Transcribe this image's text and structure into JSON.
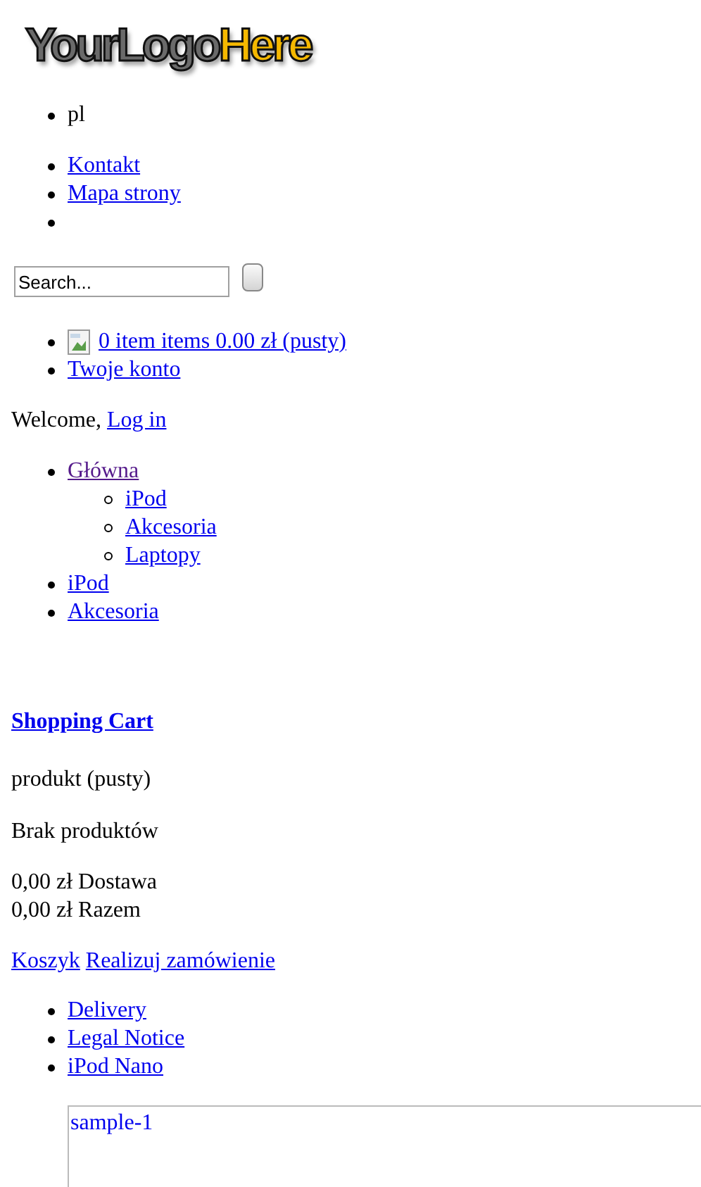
{
  "logo": {
    "text_1": "YourLogo",
    "text_2": "Here"
  },
  "language_list": [
    "pl"
  ],
  "top_links": [
    {
      "kind": "link",
      "label": "Kontakt"
    },
    {
      "kind": "link",
      "label": "Mapa strony"
    },
    {
      "kind": "empty"
    }
  ],
  "search": {
    "placeholder": "Search..."
  },
  "user_links": [
    {
      "kind": "cart",
      "label": "0 item items 0.00 zł (pusty)"
    },
    {
      "kind": "link",
      "label": "Twoje konto"
    }
  ],
  "welcome": {
    "text": "Welcome,",
    "link": "Log in"
  },
  "categories": [
    {
      "label": "Główna",
      "visited": true,
      "children": [
        {
          "label": "iPod",
          "visited": false
        },
        {
          "label": "Akcesoria",
          "visited": false
        },
        {
          "label": "Laptopy",
          "visited": false
        }
      ]
    },
    {
      "label": "iPod",
      "visited": false
    },
    {
      "label": "Akcesoria",
      "visited": false
    }
  ],
  "cart": {
    "title": "Shopping Cart",
    "product_line": "produkt (pusty)",
    "empty_message": "Brak produktów",
    "totals": [
      {
        "amount": "0,00 zł",
        "label": "Dostawa"
      },
      {
        "amount": "0,00 zł",
        "label": "Razem"
      }
    ],
    "links": [
      "Koszyk",
      "Realizuj zamówienie"
    ]
  },
  "footer_links": [
    "Delivery",
    "Legal Notice",
    "iPod Nano"
  ],
  "frame": {
    "text": "sample-1"
  }
}
